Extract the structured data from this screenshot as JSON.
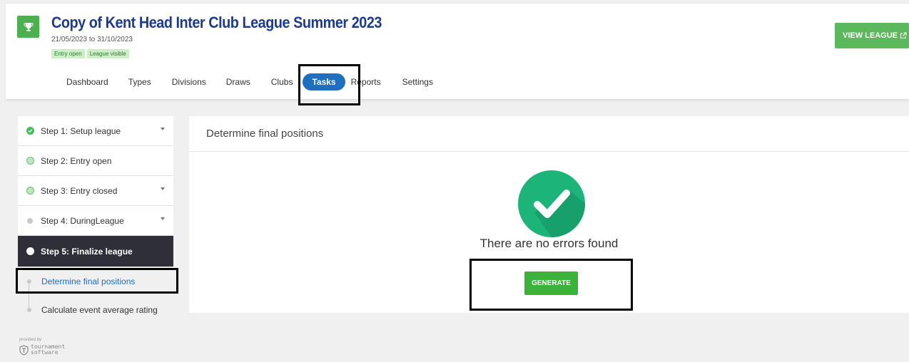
{
  "header": {
    "title": "Copy of Kent Head Inter Club League Summer 2023",
    "dates": "21/05/2023 to 31/10/2023",
    "badges": [
      "Entry open",
      "League visible"
    ],
    "view_league_label": "VIEW LEAGUE",
    "trophy_icon": "trophy-icon"
  },
  "tabs": [
    {
      "label": "Dashboard",
      "active": false
    },
    {
      "label": "Types",
      "active": false
    },
    {
      "label": "Divisions",
      "active": false
    },
    {
      "label": "Draws",
      "active": false
    },
    {
      "label": "Clubs",
      "active": false
    },
    {
      "label": "Tasks",
      "active": true
    },
    {
      "label": "Reports",
      "active": false
    },
    {
      "label": "Settings",
      "active": false
    }
  ],
  "sidebar": {
    "steps": [
      {
        "label": "Step 1: Setup league",
        "status": "complete",
        "expandable": true
      },
      {
        "label": "Step 2: Entry open",
        "status": "active-light",
        "expandable": false
      },
      {
        "label": "Step 3: Entry closed",
        "status": "active-light",
        "expandable": true
      },
      {
        "label": "Step 4: DuringLeague",
        "status": "pending",
        "expandable": true
      },
      {
        "label": "Step 5: Finalize league",
        "status": "current",
        "expandable": false
      }
    ],
    "substeps": [
      {
        "label": "Determine final positions",
        "selected": true
      },
      {
        "label": "Calculate event average rating",
        "selected": false
      }
    ]
  },
  "panel": {
    "title": "Determine final positions",
    "message": "There are no errors found",
    "generate_label": "GENERATE"
  },
  "footer": {
    "provided_by": "provided by",
    "brand_line1": "tournament",
    "brand_line2": "software"
  },
  "colors": {
    "brand_blue": "#1e3a8a",
    "accent_blue": "#1e6fbf",
    "green": "#4caf50",
    "success": "#3bb33b",
    "dark_step": "#2f2f3a"
  }
}
